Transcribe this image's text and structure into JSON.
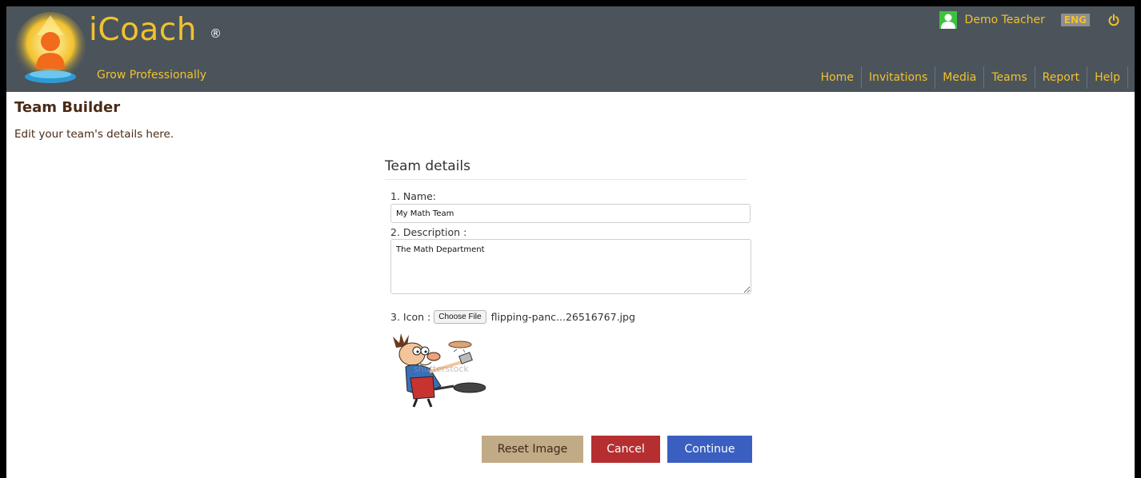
{
  "brand": {
    "name": "iCoach",
    "registered": "®",
    "tagline": "Grow Professionally"
  },
  "user": {
    "name": "Demo Teacher",
    "language": "ENG"
  },
  "nav": {
    "items": [
      "Home",
      "Invitations",
      "Media",
      "Teams",
      "Report",
      "Help"
    ]
  },
  "page": {
    "title": "Team Builder",
    "subtitle": "Edit your team's details here."
  },
  "form": {
    "section_title": "Team details",
    "name_label": "1. Name:",
    "name_value": "My Math Team",
    "description_label": "2. Description :",
    "description_value": "The Math Department",
    "icon_label": "3. Icon :",
    "choose_file_label": "Choose File",
    "file_name": "flipping-panc...26516767.jpg"
  },
  "actions": {
    "reset_label": "Reset Image",
    "cancel_label": "Cancel",
    "continue_label": "Continue"
  },
  "colors": {
    "header_bg": "#4b545b",
    "accent_yellow": "#f2c12e",
    "title_brown": "#4a2a16",
    "reset_bg": "#c1aa86",
    "cancel_bg": "#b52f31",
    "continue_bg": "#3a5fc0"
  },
  "icons": [
    "logo-mark-icon",
    "user-avatar-icon",
    "power-icon",
    "cartoon-chef-pancake-image"
  ]
}
